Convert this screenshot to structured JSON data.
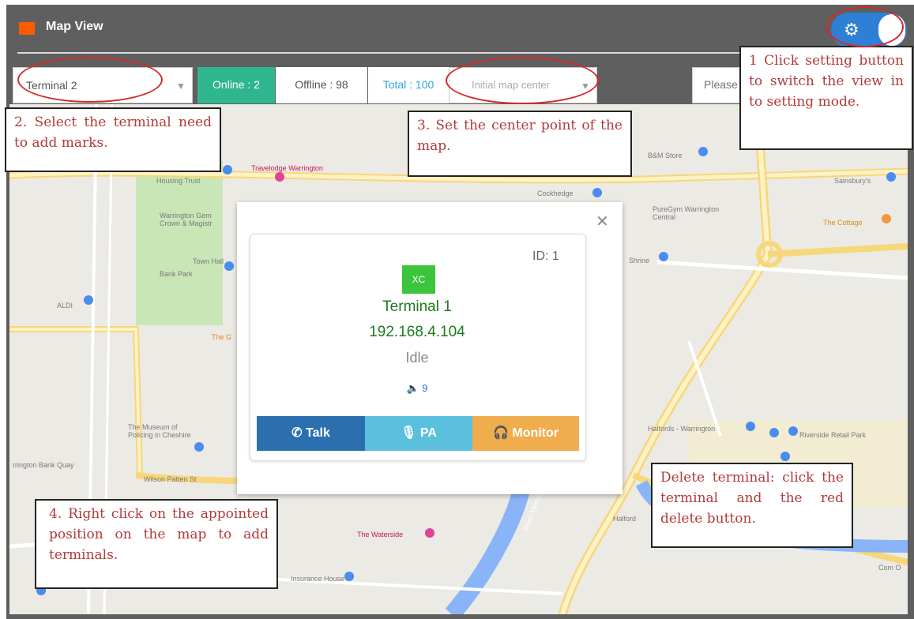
{
  "window": {
    "title": "Map View"
  },
  "toolbar": {
    "terminal_select": "Terminal 2",
    "online": "Online : 2",
    "offline": "Offline : 98",
    "total": "Total : 100",
    "map_center_select": "Initial map center",
    "search_placeholder": "Please"
  },
  "popup": {
    "id": "ID: 1",
    "badge": "XC",
    "name": "Terminal 1",
    "ip": "192.168.4.104",
    "status": "Idle",
    "volume": "9",
    "buttons": {
      "talk": "Talk",
      "pa": "PA",
      "monitor": "Monitor"
    }
  },
  "notes": {
    "n1": "1 Click setting button to switch the view in to setting mode.",
    "n2": "2. Select the terminal need to add marks.",
    "n3": "3. Set the center point of the map.",
    "n4": "4. Right click on the appointed position on the map to add terminals.",
    "delete": "Delete terminal: click the terminal and the red delete button."
  },
  "map_labels": {
    "a": "Housing Trust",
    "b": "Travelodge Warrington",
    "c": "Warrington Gem Crown & Magistr",
    "d": "Bank Park",
    "e": "ALDI",
    "f": "The G",
    "g": "The Museum of Policing in Cheshire",
    "h": "rrington Bank Quay",
    "i": "Wilson Patten St",
    "j": "B&M Store",
    "k": "Cockhedge",
    "l": "PureGym Warrington Central",
    "m": "Sainsbury's",
    "n": "The Cottage",
    "o": "Shrine",
    "p": "Halfords - Warrington",
    "q": "Riverside Retail Park",
    "r": "The Waterside",
    "s": "River Mersey",
    "t": "Halford",
    "u": "Insurance House",
    "v": "Com O",
    "w": "Town Hall"
  },
  "colors": {
    "frame": "#5f5f5f",
    "online": "#2fb68f",
    "total_text": "#2aa6d8",
    "talk": "#2c6faf",
    "pa": "#5bc0de",
    "monitor": "#f0ad4e",
    "toggle": "#2f7fd6",
    "note_text": "#b23a3a",
    "ellipse": "#d12a2a"
  },
  "icons": [
    "settings-icon",
    "map-pin-icon",
    "phone-icon",
    "microphone-icon",
    "headset-icon",
    "speaker-icon",
    "close-icon",
    "chevron-down-icon"
  ]
}
